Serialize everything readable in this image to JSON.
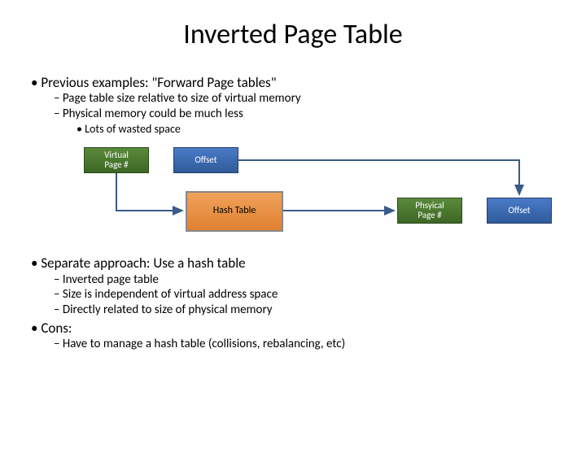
{
  "title": "Inverted Page Table",
  "bullets": {
    "b1": "Previous examples: \"Forward Page tables\"",
    "b1_1": "Page table size relative to size of virtual memory",
    "b1_2": "Physical memory could be much less",
    "b1_2_1": "Lots of wasted space",
    "b2": "Separate approach: Use a hash table",
    "b2_1": "Inverted page table",
    "b2_2": "Size is independent of virtual address space",
    "b2_3": "Directly related to size of physical memory",
    "b3": "Cons:",
    "b3_1": "Have to manage a hash table (collisions, rebalancing, etc)"
  },
  "diagram": {
    "vpage": "Virtual\nPage #",
    "offset1": "Offset",
    "hash": "Hash Table",
    "ppage": "Phsyical\nPage #",
    "offset2": "Offset"
  }
}
